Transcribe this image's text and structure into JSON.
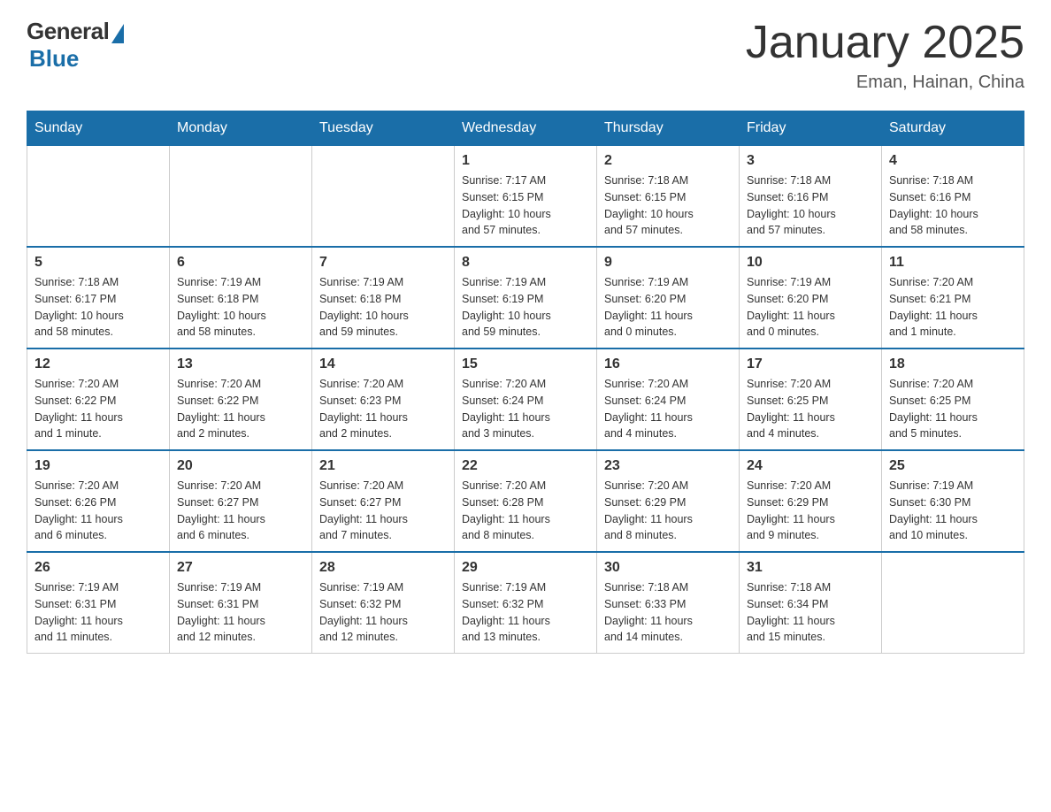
{
  "header": {
    "logo_general": "General",
    "logo_blue": "Blue",
    "month_title": "January 2025",
    "location": "Eman, Hainan, China"
  },
  "calendar": {
    "days_of_week": [
      "Sunday",
      "Monday",
      "Tuesday",
      "Wednesday",
      "Thursday",
      "Friday",
      "Saturday"
    ],
    "weeks": [
      [
        {
          "day": "",
          "info": ""
        },
        {
          "day": "",
          "info": ""
        },
        {
          "day": "",
          "info": ""
        },
        {
          "day": "1",
          "info": "Sunrise: 7:17 AM\nSunset: 6:15 PM\nDaylight: 10 hours\nand 57 minutes."
        },
        {
          "day": "2",
          "info": "Sunrise: 7:18 AM\nSunset: 6:15 PM\nDaylight: 10 hours\nand 57 minutes."
        },
        {
          "day": "3",
          "info": "Sunrise: 7:18 AM\nSunset: 6:16 PM\nDaylight: 10 hours\nand 57 minutes."
        },
        {
          "day": "4",
          "info": "Sunrise: 7:18 AM\nSunset: 6:16 PM\nDaylight: 10 hours\nand 58 minutes."
        }
      ],
      [
        {
          "day": "5",
          "info": "Sunrise: 7:18 AM\nSunset: 6:17 PM\nDaylight: 10 hours\nand 58 minutes."
        },
        {
          "day": "6",
          "info": "Sunrise: 7:19 AM\nSunset: 6:18 PM\nDaylight: 10 hours\nand 58 minutes."
        },
        {
          "day": "7",
          "info": "Sunrise: 7:19 AM\nSunset: 6:18 PM\nDaylight: 10 hours\nand 59 minutes."
        },
        {
          "day": "8",
          "info": "Sunrise: 7:19 AM\nSunset: 6:19 PM\nDaylight: 10 hours\nand 59 minutes."
        },
        {
          "day": "9",
          "info": "Sunrise: 7:19 AM\nSunset: 6:20 PM\nDaylight: 11 hours\nand 0 minutes."
        },
        {
          "day": "10",
          "info": "Sunrise: 7:19 AM\nSunset: 6:20 PM\nDaylight: 11 hours\nand 0 minutes."
        },
        {
          "day": "11",
          "info": "Sunrise: 7:20 AM\nSunset: 6:21 PM\nDaylight: 11 hours\nand 1 minute."
        }
      ],
      [
        {
          "day": "12",
          "info": "Sunrise: 7:20 AM\nSunset: 6:22 PM\nDaylight: 11 hours\nand 1 minute."
        },
        {
          "day": "13",
          "info": "Sunrise: 7:20 AM\nSunset: 6:22 PM\nDaylight: 11 hours\nand 2 minutes."
        },
        {
          "day": "14",
          "info": "Sunrise: 7:20 AM\nSunset: 6:23 PM\nDaylight: 11 hours\nand 2 minutes."
        },
        {
          "day": "15",
          "info": "Sunrise: 7:20 AM\nSunset: 6:24 PM\nDaylight: 11 hours\nand 3 minutes."
        },
        {
          "day": "16",
          "info": "Sunrise: 7:20 AM\nSunset: 6:24 PM\nDaylight: 11 hours\nand 4 minutes."
        },
        {
          "day": "17",
          "info": "Sunrise: 7:20 AM\nSunset: 6:25 PM\nDaylight: 11 hours\nand 4 minutes."
        },
        {
          "day": "18",
          "info": "Sunrise: 7:20 AM\nSunset: 6:25 PM\nDaylight: 11 hours\nand 5 minutes."
        }
      ],
      [
        {
          "day": "19",
          "info": "Sunrise: 7:20 AM\nSunset: 6:26 PM\nDaylight: 11 hours\nand 6 minutes."
        },
        {
          "day": "20",
          "info": "Sunrise: 7:20 AM\nSunset: 6:27 PM\nDaylight: 11 hours\nand 6 minutes."
        },
        {
          "day": "21",
          "info": "Sunrise: 7:20 AM\nSunset: 6:27 PM\nDaylight: 11 hours\nand 7 minutes."
        },
        {
          "day": "22",
          "info": "Sunrise: 7:20 AM\nSunset: 6:28 PM\nDaylight: 11 hours\nand 8 minutes."
        },
        {
          "day": "23",
          "info": "Sunrise: 7:20 AM\nSunset: 6:29 PM\nDaylight: 11 hours\nand 8 minutes."
        },
        {
          "day": "24",
          "info": "Sunrise: 7:20 AM\nSunset: 6:29 PM\nDaylight: 11 hours\nand 9 minutes."
        },
        {
          "day": "25",
          "info": "Sunrise: 7:19 AM\nSunset: 6:30 PM\nDaylight: 11 hours\nand 10 minutes."
        }
      ],
      [
        {
          "day": "26",
          "info": "Sunrise: 7:19 AM\nSunset: 6:31 PM\nDaylight: 11 hours\nand 11 minutes."
        },
        {
          "day": "27",
          "info": "Sunrise: 7:19 AM\nSunset: 6:31 PM\nDaylight: 11 hours\nand 12 minutes."
        },
        {
          "day": "28",
          "info": "Sunrise: 7:19 AM\nSunset: 6:32 PM\nDaylight: 11 hours\nand 12 minutes."
        },
        {
          "day": "29",
          "info": "Sunrise: 7:19 AM\nSunset: 6:32 PM\nDaylight: 11 hours\nand 13 minutes."
        },
        {
          "day": "30",
          "info": "Sunrise: 7:18 AM\nSunset: 6:33 PM\nDaylight: 11 hours\nand 14 minutes."
        },
        {
          "day": "31",
          "info": "Sunrise: 7:18 AM\nSunset: 6:34 PM\nDaylight: 11 hours\nand 15 minutes."
        },
        {
          "day": "",
          "info": ""
        }
      ]
    ]
  }
}
